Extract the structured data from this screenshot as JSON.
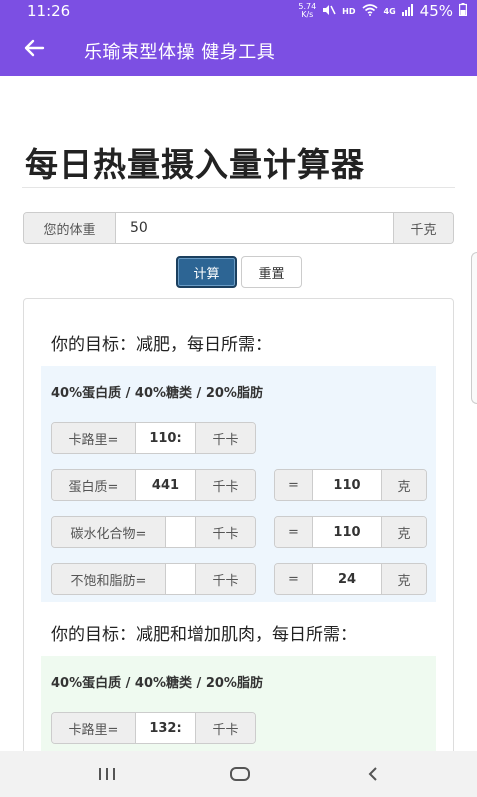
{
  "status_bar": {
    "time": "11:26",
    "speed_value": "5.74",
    "speed_unit": "K/s",
    "network_mini": "HD",
    "network_gen": "4G",
    "battery": "45%"
  },
  "app_bar": {
    "title": "乐瑜束型体操 健身工具"
  },
  "page": {
    "title": "每日热量摄入量计算器"
  },
  "weight_form": {
    "label": "您的体重",
    "value": "50",
    "unit": "千克",
    "calc_button": "计算",
    "reset_button": "重置"
  },
  "goal_lose": {
    "heading": "你的目标：减肥，每日所需：",
    "ratio": "40%蛋白质 / 40%糖类 / 20%脂肪",
    "calories": {
      "label": "卡路里=",
      "value": "110:",
      "unit": "千卡"
    },
    "protein": {
      "label": "蛋白质=",
      "value": "441",
      "unit": "千卡",
      "eq": "=",
      "grams": "110",
      "gram_unit": "克"
    },
    "carbs": {
      "label": "碳水化合物=",
      "value": "",
      "unit": "千卡",
      "eq": "=",
      "grams": "110",
      "gram_unit": "克"
    },
    "fat": {
      "label": "不饱和脂肪=",
      "value": "",
      "unit": "千卡",
      "eq": "=",
      "grams": "24",
      "gram_unit": "克"
    }
  },
  "goal_gain": {
    "heading": "你的目标：减肥和增加肌肉，每日所需：",
    "ratio": "40%蛋白质 / 40%糖类 / 20%脂肪",
    "calories": {
      "label": "卡路里=",
      "value": "132:",
      "unit": "千卡"
    }
  },
  "colors": {
    "header": "#7c4fe3",
    "primary_button": "#2d6594",
    "block_blue": "#eef6fd",
    "block_green": "#effaf0"
  },
  "icons": {
    "back": "back-arrow-icon",
    "wifi": "wifi-icon",
    "signal": "signal-icon",
    "battery": "battery-icon",
    "recents": "recents-icon",
    "home": "home-icon",
    "nav_back": "nav-back-icon"
  }
}
